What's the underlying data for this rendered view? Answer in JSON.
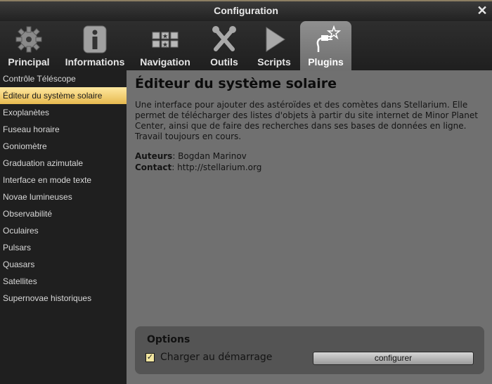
{
  "window": {
    "title": "Configuration"
  },
  "tabs": [
    {
      "label": "Principal",
      "icon": "gear-icon"
    },
    {
      "label": "Informations",
      "icon": "info-icon"
    },
    {
      "label": "Navigation",
      "icon": "navigation-icon"
    },
    {
      "label": "Outils",
      "icon": "tools-icon"
    },
    {
      "label": "Scripts",
      "icon": "play-icon"
    },
    {
      "label": "Plugins",
      "icon": "plug-icon",
      "active": true
    }
  ],
  "sidebar": {
    "items": [
      "Contrôle Téléscope",
      "Éditeur du système solaire",
      "Exoplanètes",
      "Fuseau horaire",
      "Goniomètre",
      "Graduation azimutale",
      "Interface en mode texte",
      "Novae lumineuses",
      "Observabilité",
      "Oculaires",
      "Pulsars",
      "Quasars",
      "Satellites",
      "Supernovae historiques"
    ],
    "selected_index": 1
  },
  "plugin": {
    "title": "Éditeur du système solaire",
    "description": "Une interface pour ajouter des astéroïdes et des comètes dans Stellarium. Elle permet de télécharger des listes d'objets à partir du site internet de Minor Planet Center, ainsi que de faire des recherches dans ses bases de données en ligne. Travail toujours en cours.",
    "authors_label": "Auteurs",
    "authors_value": ": Bogdan Marinov",
    "contact_label": "Contact",
    "contact_value": ": http://stellarium.org"
  },
  "options": {
    "title": "Options",
    "load_at_startup_label": "Charger au démarrage",
    "load_at_startup_checked": true,
    "configure_button": "configurer"
  },
  "colors": {
    "selection": "#e6b94f",
    "content_bg": "#707070",
    "sidebar_bg": "#1f1f1f"
  }
}
